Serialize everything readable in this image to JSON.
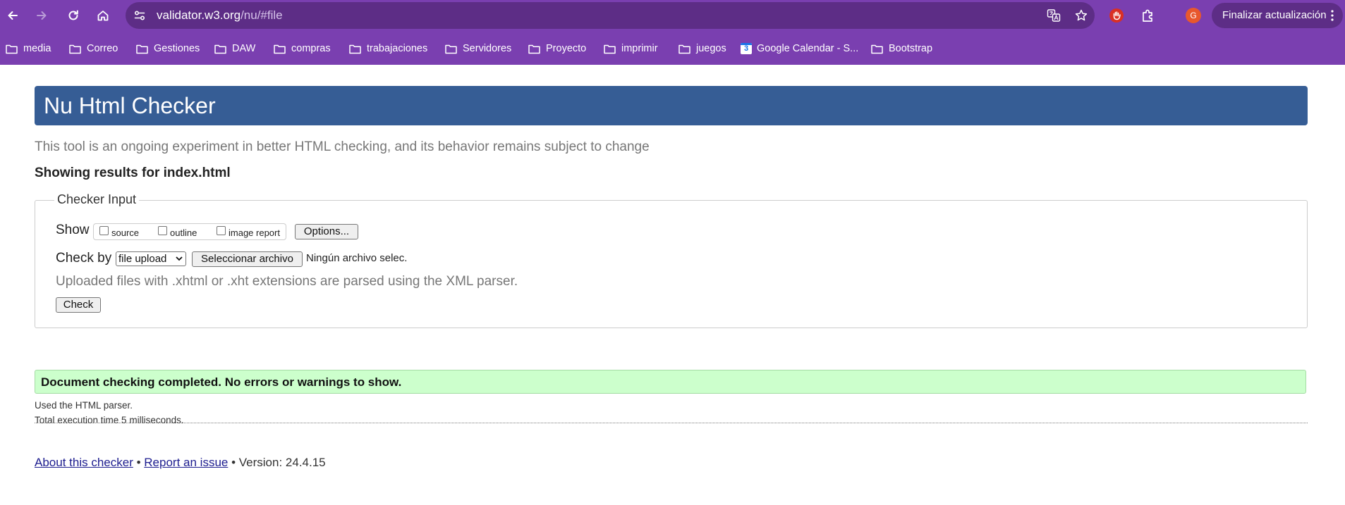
{
  "browser": {
    "url_host": "validator.w3.org",
    "url_path": "/nu/#file",
    "avatar_letter": "G",
    "update_button": "Finalizar actualización",
    "bookmarks": [
      {
        "label": "media",
        "type": "folder"
      },
      {
        "label": "Correo",
        "type": "folder"
      },
      {
        "label": "Gestiones",
        "type": "folder"
      },
      {
        "label": "DAW",
        "type": "folder"
      },
      {
        "label": "compras",
        "type": "folder"
      },
      {
        "label": "trabajaciones",
        "type": "folder"
      },
      {
        "label": "Servidores",
        "type": "folder"
      },
      {
        "label": "Proyecto",
        "type": "folder"
      },
      {
        "label": "imprimir",
        "type": "folder"
      },
      {
        "label": "juegos",
        "type": "folder"
      },
      {
        "label": "Google Calendar - S...",
        "type": "calendar",
        "icon_text": "3"
      },
      {
        "label": "Bootstrap",
        "type": "folder"
      }
    ],
    "colors": {
      "chrome": "#7a3fb0",
      "omnibox": "#5d2d86"
    }
  },
  "page": {
    "title": "Nu Html Checker",
    "intro": "This tool is an ongoing experiment in better HTML checking, and its behavior remains subject to change",
    "results_heading": "Showing results for index.html",
    "checker_input": {
      "legend": "Checker Input",
      "show_label": "Show",
      "show_options": [
        "source",
        "outline",
        "image report"
      ],
      "options_button": "Options...",
      "check_by_label": "Check by",
      "check_by_value": "file upload",
      "choose_file_button": "Seleccionar archivo",
      "file_status": "Ningún archivo selec.",
      "xml_note": "Uploaded files with .xhtml or .xht extensions are parsed using the XML parser.",
      "check_button": "Check"
    },
    "success_message": "Document checking completed. No errors or warnings to show.",
    "parser_note": "Used the HTML parser.",
    "execution_note": "Total execution time 5 milliseconds.",
    "footer": {
      "about_link": "About this checker",
      "separator": "•",
      "report_link": "Report an issue",
      "version": "• Version: 24.4.15"
    },
    "colors": {
      "title_bar": "#365d95",
      "success_bg": "#ccffcc",
      "link": "#1d1d8f"
    }
  }
}
